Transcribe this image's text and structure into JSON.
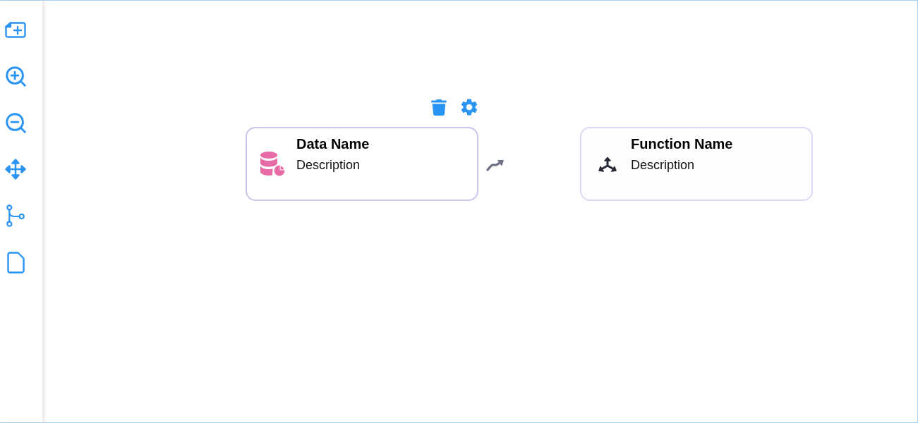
{
  "canvas": {
    "nodes": [
      {
        "kind": "data",
        "title": "Data Name",
        "description": "Description",
        "selected": true
      },
      {
        "kind": "function",
        "title": "Function Name",
        "description": "Description",
        "selected": false
      }
    ]
  }
}
